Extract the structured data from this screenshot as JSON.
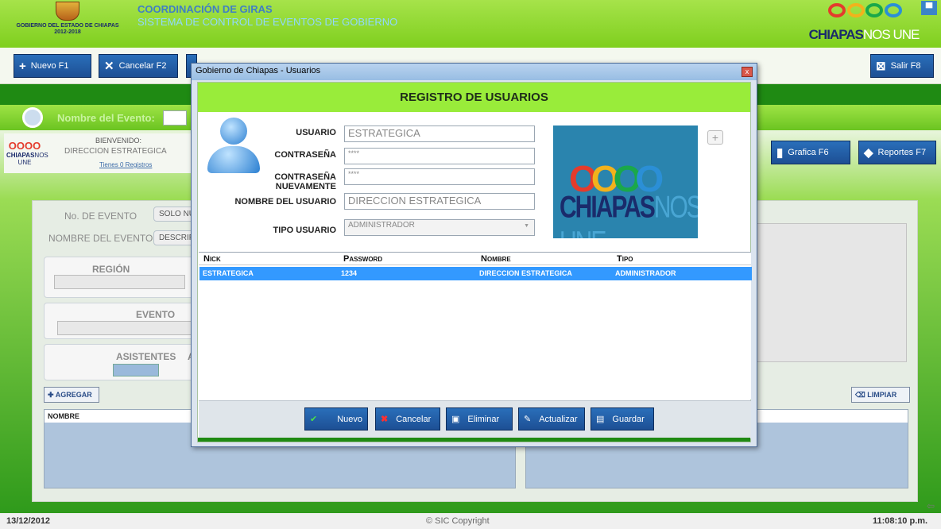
{
  "header": {
    "gov_line1": "GOBIERNO DEL ESTADO DE CHIAPAS",
    "gov_line2": "2012-2018",
    "app_title": "COORDINACIÓN DE GIRAS",
    "app_subtitle": "SISTEMA DE CONTROL DE EVENTOS DE GOBIERNO",
    "brand_bold": "CHIAPAS",
    "brand_light": "NOS UNE",
    "close_glyph": "▀"
  },
  "toolbar": {
    "nuevo": "Nuevo F1",
    "cancelar": "Cancelar F2",
    "salir": "Salir F8",
    "grafica": "Grafica F6",
    "reportes": "Reportes F7"
  },
  "search": {
    "label": "Nombre del Evento:"
  },
  "welcome": {
    "title": "BIENVENIDO:",
    "user": "DIRECCION ESTRATEGICA",
    "registros": "Tienes 0 Registros"
  },
  "form": {
    "no_evento_label": "No. DE EVENTO",
    "no_evento_placeholder": "SOLO NÚ",
    "nombre_evento_label": "NOMBRE DEL EVENTO",
    "nombre_evento_placeholder": "DESCRIP",
    "region_label": "REGIÓN",
    "evento_label": "EVENTO",
    "asistentes_label": "ASISTENTES",
    "asistentes_extra": "A",
    "agregar": "AGREGAR",
    "limpiar": "LIMPIAR",
    "nombre_col": "NOMBRE"
  },
  "dialog": {
    "window_title": "Gobierno de Chiapas - Usuarios",
    "close_glyph": "x",
    "heading": "REGISTRO DE USUARIOS",
    "usuario_label": "USUARIO",
    "usuario_value": "ESTRATEGICA",
    "contrasena_label": "CONTRASEÑA",
    "contrasena_value": "****",
    "contrasena2_label": "CONTRASEÑA NUEVAMENTE",
    "contrasena2_value": "****",
    "nombre_label": "NOMBRE DEL USUARIO",
    "nombre_value": "DIRECCION ESTRATEGICA",
    "tipo_label": "TIPO USUARIO",
    "tipo_value": "ADMINISTRADOR",
    "add_photo_glyph": "+",
    "logo_bold": "CHIAPAS",
    "logo_light": "NOS UNE",
    "columns": [
      "Nick",
      "Password",
      "Nombre",
      "Tipo"
    ],
    "rows": [
      [
        "ESTRATEGICA",
        "1234",
        "DIRECCION ESTRATEGICA",
        "ADMINISTRADOR"
      ]
    ],
    "buttons": {
      "nuevo": "Nuevo",
      "cancelar": "Cancelar",
      "eliminar": "Eliminar",
      "actualizar": "Actualizar",
      "guardar": "Guardar"
    }
  },
  "footer": {
    "date": "13/12/2012",
    "copyright": "© SIC Copyright",
    "time": "11:08:10 p.m."
  },
  "colors": {
    "green_header": "#8fd93a",
    "dark_green": "#1f8a13",
    "button_blue": "#1f5ca8",
    "selected_row": "#3399ff"
  }
}
